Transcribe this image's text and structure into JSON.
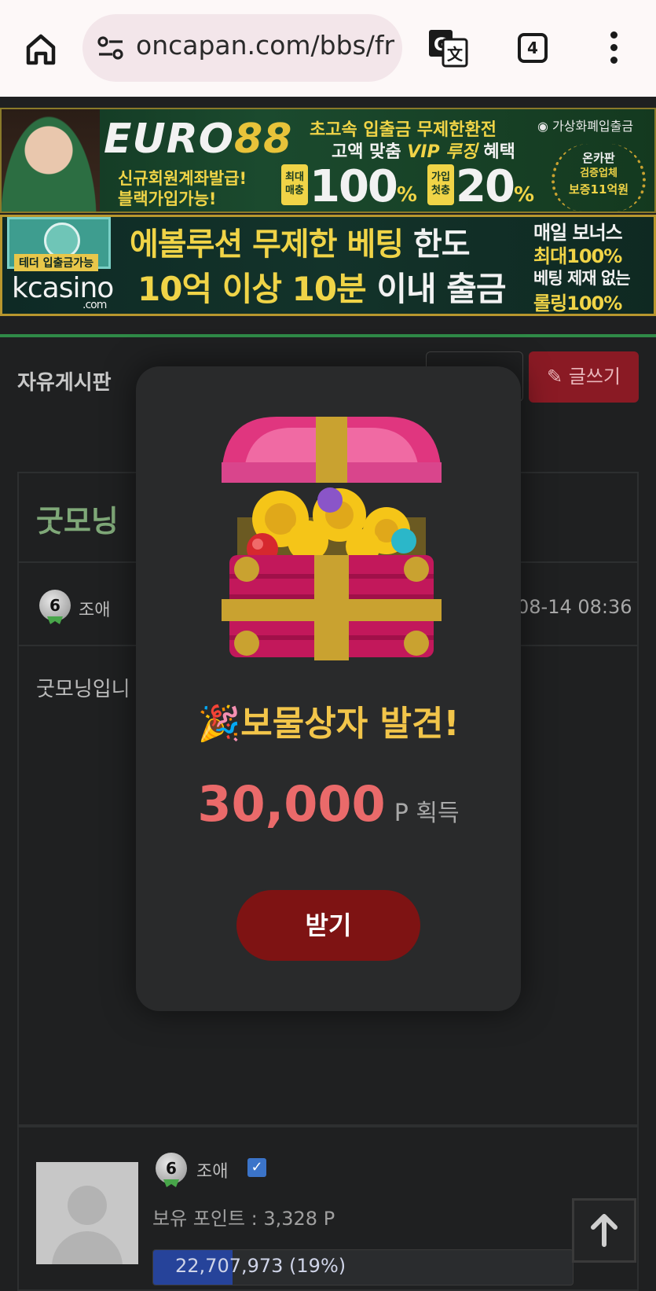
{
  "browser": {
    "url": "oncapan.com/bbs/fre",
    "tab_count": "4"
  },
  "banner1": {
    "logo_main": "EURO",
    "logo_num": "88",
    "left_line1": "신규회원계좌발급!",
    "left_line2": "블랙가입가능!",
    "promo_line1": "초고속 입출금 무제한환전",
    "promo_line2_a": "고액 맞춤 ",
    "promo_line2_vip": "VIP 루징",
    "promo_line2_b": " 혜택",
    "box1": "최대\n매충",
    "big1": "100",
    "box2": "가입\n첫충",
    "big2": "20",
    "percent": "%",
    "crypto_text": "가상화폐입출금",
    "award_line1": "온카판",
    "award_line2": "검증업체",
    "award_line3": "보증11억원"
  },
  "banner2": {
    "tether_label": "테더 입출금가능",
    "brand": "kcasino",
    "brand_suffix": ".com",
    "line1_a": "에볼루션 무제한 베팅 ",
    "line1_b": "한도",
    "line2_a": "10억 이상 10분 ",
    "line2_b": "이내 출금",
    "right1": "매일 보너스",
    "right2": "최대100%",
    "right3": "베팅 제재 없는",
    "right4": "롤링100%"
  },
  "board": {
    "title": "자유게시판",
    "write_label": "글쓰기"
  },
  "post": {
    "title": "굿모닝",
    "author_level": "6",
    "author": "조애",
    "date_partial": "08-14 08:36",
    "body": "굿모닝입니"
  },
  "profile": {
    "level": "6",
    "name": "조애",
    "points_label": "보유 포인트 : 3,328 P",
    "progress_text": "22,707,973 (19%)",
    "progress_fraction": 0.19
  },
  "modal": {
    "title": "보물상자 발견!",
    "amount": "30,000",
    "unit": "P 획득",
    "claim_label": "받기"
  },
  "colors": {
    "accent_red": "#7e1313",
    "amount_red": "#ea6a6a",
    "title_gold": "#f2c54a",
    "board_green": "#2f8a47"
  }
}
